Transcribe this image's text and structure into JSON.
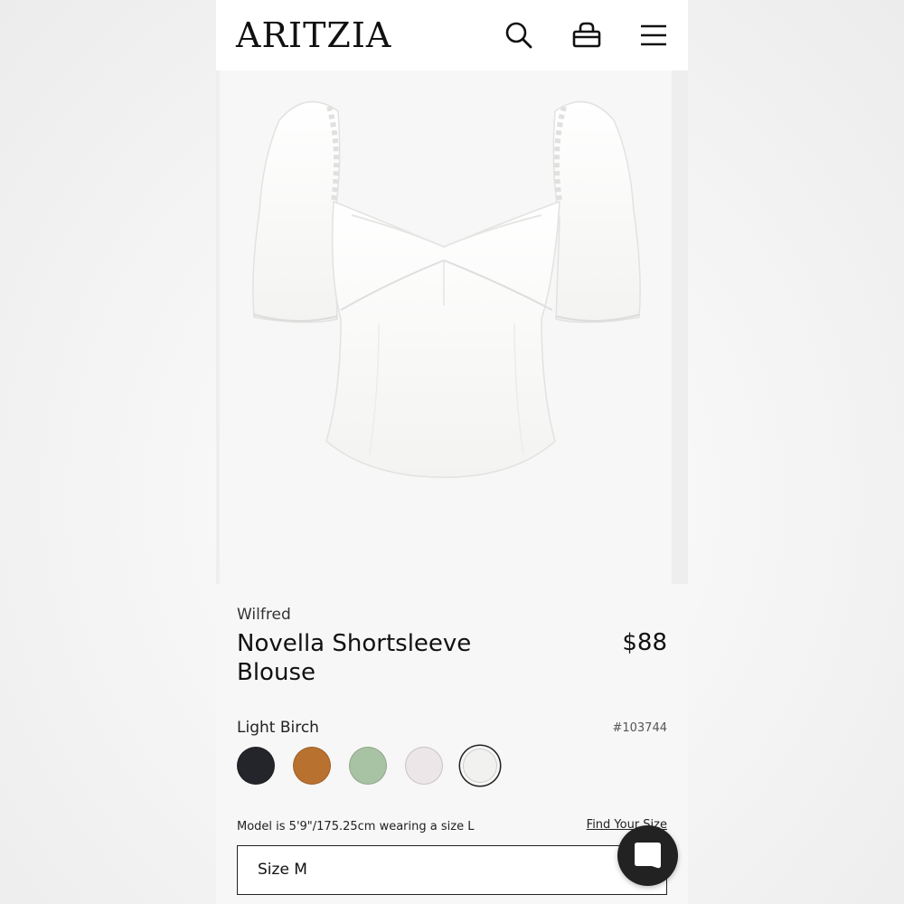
{
  "header": {
    "logo": "ARITZIA",
    "icons": [
      "search-icon",
      "bag-icon",
      "menu-icon"
    ]
  },
  "product": {
    "brand": "Wilfred",
    "name": "Novella Shortsleeve Blouse",
    "price": "$88",
    "color_name": "Light Birch",
    "sku": "#103744",
    "swatches": [
      {
        "color": "#23252b",
        "selected": false
      },
      {
        "color": "#b8712f",
        "selected": false
      },
      {
        "color": "#a8c3a3",
        "selected": false
      },
      {
        "color": "#ece6e8",
        "selected": false
      },
      {
        "color": "#f1f1ef",
        "selected": true
      }
    ],
    "model_note": "Model is 5'9\"/175.25cm wearing a size L",
    "find_size_label": "Find Your Size",
    "size_value": "Size M"
  },
  "chat": {
    "icon": "chat-icon"
  }
}
